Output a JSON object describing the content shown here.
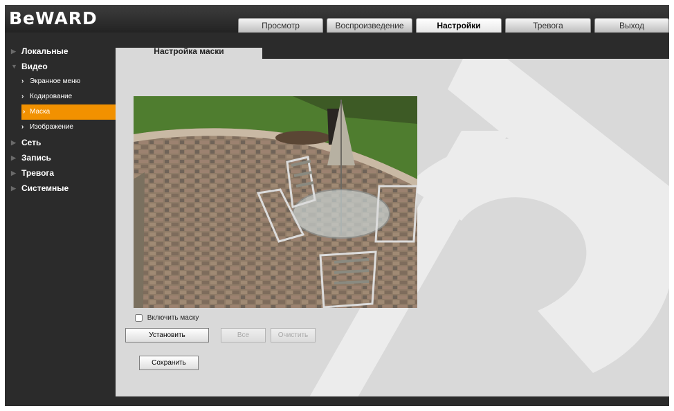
{
  "header": {
    "logo": "BeWARD"
  },
  "tabs": [
    {
      "label": "Просмотр",
      "active": false
    },
    {
      "label": "Воспроизведение",
      "active": false
    },
    {
      "label": "Настройки",
      "active": true
    },
    {
      "label": "Тревога",
      "active": false
    },
    {
      "label": "Выход",
      "active": false
    }
  ],
  "sidebar": {
    "items": [
      {
        "label": "Локальные"
      },
      {
        "label": "Видео",
        "expanded": true,
        "children": [
          {
            "label": "Экранное меню"
          },
          {
            "label": "Кодирование"
          },
          {
            "label": "Маска",
            "active": true
          },
          {
            "label": "Изображение"
          }
        ]
      },
      {
        "label": "Сеть"
      },
      {
        "label": "Запись"
      },
      {
        "label": "Тревога"
      },
      {
        "label": "Системные"
      }
    ]
  },
  "page": {
    "tab_title": "Настройка маски",
    "enable_mask_label": "Включить маску",
    "enable_mask_checked": false,
    "buttons": {
      "set": "Установить",
      "all": "Все",
      "clear": "Очистить",
      "save": "Сохранить"
    }
  },
  "colors": {
    "accent": "#f29100",
    "background": "#2b2b2b",
    "panel": "#d9d9d9"
  }
}
